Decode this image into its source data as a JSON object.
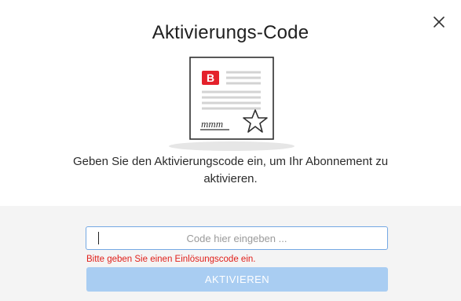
{
  "dialog": {
    "title": "Aktivierungs-Code",
    "description": "Geben Sie den Aktivierungscode ein, um Ihr Abonnement zu aktivieren.",
    "close_icon": "close-icon",
    "illustration": {
      "icon": "certificate-icon",
      "badge_letter": "B",
      "signature_text": "mmm",
      "badge_color": "#e4212b"
    }
  },
  "form": {
    "input_value": "",
    "input_placeholder": "Code hier eingeben ...",
    "error_message": "Bitte geben Sie einen Einlösungscode ein.",
    "submit_label": "AKTIVIEREN"
  },
  "colors": {
    "accent": "#74a8e3",
    "button_disabled": "#a9cdf2",
    "error": "#e0201b",
    "form_background": "#f4f4f4"
  }
}
